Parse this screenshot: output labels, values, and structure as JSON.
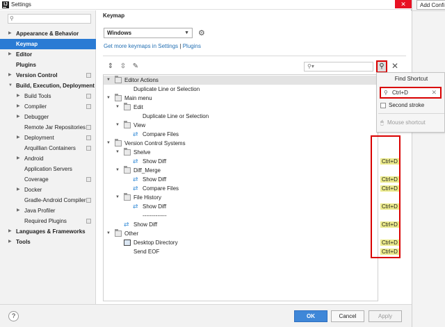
{
  "window": {
    "title": "Settings",
    "app_icon": "IJ",
    "close_glyph": "✕"
  },
  "background_app": {
    "add_config_label": "Add Confi"
  },
  "sidebar": {
    "search_placeholder": "",
    "items": [
      {
        "label": "Appearance & Behavior",
        "bold": true,
        "arrow": "▶",
        "indent": 0,
        "copy": false
      },
      {
        "label": "Keymap",
        "bold": true,
        "arrow": "",
        "indent": 0,
        "copy": false,
        "selected": true
      },
      {
        "label": "Editor",
        "bold": true,
        "arrow": "▶",
        "indent": 0,
        "copy": false
      },
      {
        "label": "Plugins",
        "bold": true,
        "arrow": "",
        "indent": 0,
        "copy": false
      },
      {
        "label": "Version Control",
        "bold": true,
        "arrow": "▶",
        "indent": 0,
        "copy": true
      },
      {
        "label": "Build, Execution, Deployment",
        "bold": true,
        "arrow": "▼",
        "indent": 0,
        "copy": false
      },
      {
        "label": "Build Tools",
        "bold": false,
        "arrow": "▶",
        "indent": 1,
        "copy": true
      },
      {
        "label": "Compiler",
        "bold": false,
        "arrow": "▶",
        "indent": 1,
        "copy": true
      },
      {
        "label": "Debugger",
        "bold": false,
        "arrow": "▶",
        "indent": 1,
        "copy": false
      },
      {
        "label": "Remote Jar Repositories",
        "bold": false,
        "arrow": "",
        "indent": 1,
        "copy": true
      },
      {
        "label": "Deployment",
        "bold": false,
        "arrow": "▶",
        "indent": 1,
        "copy": true
      },
      {
        "label": "Arquillian Containers",
        "bold": false,
        "arrow": "",
        "indent": 1,
        "copy": true
      },
      {
        "label": "Android",
        "bold": false,
        "arrow": "▶",
        "indent": 1,
        "copy": false
      },
      {
        "label": "Application Servers",
        "bold": false,
        "arrow": "",
        "indent": 1,
        "copy": false
      },
      {
        "label": "Coverage",
        "bold": false,
        "arrow": "",
        "indent": 1,
        "copy": true
      },
      {
        "label": "Docker",
        "bold": false,
        "arrow": "▶",
        "indent": 1,
        "copy": false
      },
      {
        "label": "Gradle-Android Compiler",
        "bold": false,
        "arrow": "",
        "indent": 1,
        "copy": true
      },
      {
        "label": "Java Profiler",
        "bold": false,
        "arrow": "▶",
        "indent": 1,
        "copy": false
      },
      {
        "label": "Required Plugins",
        "bold": false,
        "arrow": "",
        "indent": 1,
        "copy": true
      },
      {
        "label": "Languages & Frameworks",
        "bold": true,
        "arrow": "▶",
        "indent": 0,
        "copy": false
      },
      {
        "label": "Tools",
        "bold": true,
        "arrow": "▶",
        "indent": 0,
        "copy": false
      }
    ]
  },
  "main": {
    "heading": "Keymap",
    "keymap_value": "Windows",
    "link_text_1": "Get more keymaps in Settings",
    "link_sep": "|",
    "link_text_2": "Plugins",
    "filter_placeholder": ""
  },
  "tree": [
    {
      "label": "Editor Actions",
      "level": 0,
      "toggle": "▼",
      "icon": "folder",
      "shortcut": "",
      "highlight": true
    },
    {
      "label": "Duplicate Line or Selection",
      "level": 1,
      "toggle": "",
      "icon": "",
      "shortcut": ""
    },
    {
      "label": "Main menu",
      "level": 0,
      "toggle": "▼",
      "icon": "folder",
      "shortcut": ""
    },
    {
      "label": "Edit",
      "level": 1,
      "toggle": "▼",
      "icon": "folder",
      "shortcut": ""
    },
    {
      "label": "Duplicate Line or Selection",
      "level": 2,
      "toggle": "",
      "icon": "",
      "shortcut": ""
    },
    {
      "label": "View",
      "level": 1,
      "toggle": "▼",
      "icon": "folder",
      "shortcut": ""
    },
    {
      "label": "Compare Files",
      "level": 2,
      "toggle": "",
      "icon": "action",
      "shortcut": ""
    },
    {
      "label": "Version Control Systems",
      "level": 0,
      "toggle": "▼",
      "icon": "folder",
      "shortcut": ""
    },
    {
      "label": "Shelve",
      "level": 1,
      "toggle": "▼",
      "icon": "folder",
      "shortcut": ""
    },
    {
      "label": "Show Diff",
      "level": 2,
      "toggle": "",
      "icon": "action",
      "shortcut": "Ctrl+D"
    },
    {
      "label": "Diff_Merge",
      "level": 1,
      "toggle": "▼",
      "icon": "folder",
      "shortcut": ""
    },
    {
      "label": "Show Diff",
      "level": 2,
      "toggle": "",
      "icon": "action",
      "shortcut": "Ctrl+D"
    },
    {
      "label": "Compare Files",
      "level": 2,
      "toggle": "",
      "icon": "action",
      "shortcut": "Ctrl+D"
    },
    {
      "label": "File History",
      "level": 1,
      "toggle": "▼",
      "icon": "folder",
      "shortcut": ""
    },
    {
      "label": "Show Diff",
      "level": 2,
      "toggle": "",
      "icon": "action",
      "shortcut": "Ctrl+D"
    },
    {
      "label": "-------------",
      "level": 2,
      "toggle": "",
      "icon": "",
      "shortcut": ""
    },
    {
      "label": "Show Diff",
      "level": 1,
      "toggle": "",
      "icon": "action",
      "shortcut": "Ctrl+D"
    },
    {
      "label": "Other",
      "level": 0,
      "toggle": "▼",
      "icon": "folder",
      "shortcut": ""
    },
    {
      "label": "Desktop Directory",
      "level": 1,
      "toggle": "",
      "icon": "monitor",
      "shortcut": "Ctrl+D"
    },
    {
      "label": "Send EOF",
      "level": 1,
      "toggle": "",
      "icon": "",
      "shortcut": "Ctrl+D"
    }
  ],
  "find_popup": {
    "title": "Find Shortcut",
    "shortcut_value": "Ctrl+D",
    "second_stroke_label": "Second stroke",
    "mouse_shortcut_label": "Mouse shortcut"
  },
  "footer": {
    "help_label": "?",
    "ok_label": "OK",
    "cancel_label": "Cancel",
    "apply_label": "Apply"
  },
  "colors": {
    "accent": "#2a7bd4",
    "highlight_red": "#d90000",
    "shortcut_bg": "#eceb8c"
  }
}
